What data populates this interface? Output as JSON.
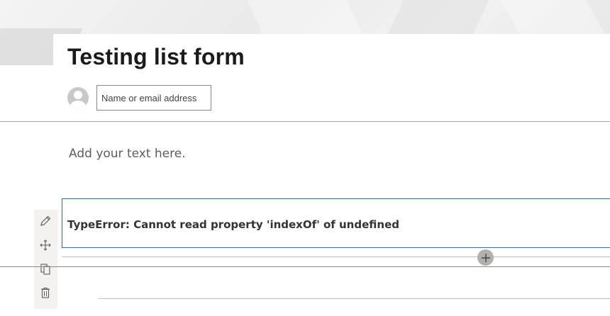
{
  "page": {
    "title": "Testing list form"
  },
  "people_picker": {
    "placeholder": "Name or email address"
  },
  "text_webpart": {
    "placeholder": "Add your text here."
  },
  "error_webpart": {
    "message": "TypeError: Cannot read property 'indexOf' of undefined"
  },
  "toolbar": {
    "items": [
      {
        "icon": "pencil-icon",
        "action": "edit"
      },
      {
        "icon": "move-icon",
        "action": "move"
      },
      {
        "icon": "duplicate-icon",
        "action": "duplicate"
      },
      {
        "icon": "trash-icon",
        "action": "delete"
      }
    ]
  },
  "colors": {
    "selected_border": "#2b6c9e",
    "add_button": "#b3b0ad",
    "toolbar_bg": "#f3f2f1"
  }
}
